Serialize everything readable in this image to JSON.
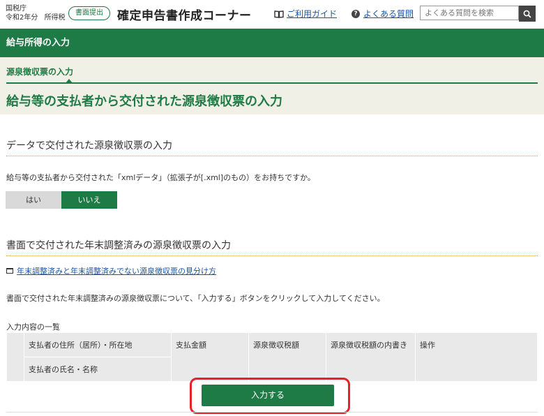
{
  "header": {
    "agency": "国税庁",
    "year": "令和2年分",
    "tax_type": "所得税",
    "submit_pill": "書面提出",
    "app_title": "確定申告書作成コーナー",
    "guide_link": "ご利用ガイド",
    "faq_link": "よくある質問",
    "search_placeholder": "よくある質問を検索"
  },
  "section_bar": {
    "title": "給与所得の入力"
  },
  "sub": {
    "title": "源泉徴収票の入力",
    "main_title": "給与等の支払者から交付された源泉徴収票の入力"
  },
  "data_section": {
    "heading": "データで交付された源泉徴収票の入力",
    "question": "給与等の支払者から交付された「xmlデータ」（拡張子が[.xml]のもの）をお持ちですか。",
    "yes_label": "はい",
    "no_label": "いいえ",
    "selected": "いいえ"
  },
  "paper_section": {
    "heading": "書面で交付された年末調整済みの源泉徴収票の入力",
    "help_link": "年末調整済みと年末調整済みでない源泉徴収票の見分け方",
    "instruction": "書面で交付された年末調整済みの源泉徴収票について、「入力する」ボタンをクリックして入力してください。",
    "list_caption": "入力内容の一覧",
    "columns": {
      "payer_address": "支払者の住所（居所）・所在地",
      "payer_name": "支払者の氏名・名称",
      "amount": "支払金額",
      "withholding": "源泉徴収税額",
      "withholding_detail": "源泉徴収税額の内書き",
      "action": "操作"
    },
    "enter_button": "入力する"
  },
  "colors": {
    "brand_green": "#1e7b45",
    "beige": "#f1f0e6",
    "highlight_red": "#e8202a",
    "link_blue": "#1a55a5"
  }
}
